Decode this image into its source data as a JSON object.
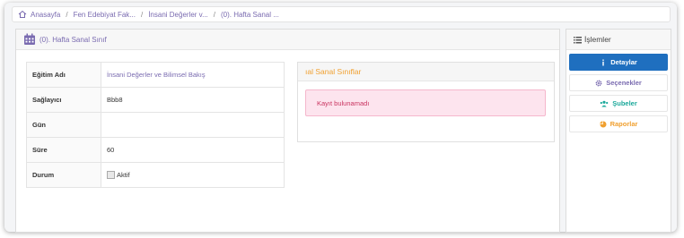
{
  "breadcrumb": {
    "items": [
      "Anasayfa",
      "Fen Edebiyat Fak...",
      "İnsani Değerler v...",
      "(0). Hafta Sanal ..."
    ],
    "separator": "/"
  },
  "left_card": {
    "title": "(0). Hafta Sanal Sınıf"
  },
  "details": [
    {
      "label": "Eğitim Adı",
      "value": "İnsani Değerler ve Bilimsel Bakış"
    },
    {
      "label": "Sağlayıcı",
      "value": "Bbb8"
    },
    {
      "label": "Gün",
      "value": ""
    },
    {
      "label": "Süre",
      "value": "60"
    },
    {
      "label": "Durum",
      "value": "Aktif"
    }
  ],
  "virtual_classes": {
    "title": "ıal Sanal Sınıflar",
    "empty_message": "Kayıt bulunamadı"
  },
  "actions": {
    "title": "İşlemler",
    "items": [
      {
        "label": "Detaylar",
        "icon": "info-icon",
        "color": "#ffffff"
      },
      {
        "label": "Seçenekler",
        "icon": "cog-icon",
        "color": "#7a6bb0"
      },
      {
        "label": "Şubeler",
        "icon": "users-icon",
        "color": "#1aa89a"
      },
      {
        "label": "Raporlar",
        "icon": "pie-chart-icon",
        "color": "#f0a030"
      }
    ]
  },
  "colors": {
    "accent_purple": "#7a6bb0",
    "primary_blue": "#1f6fbf",
    "alert_pink": "#fde4ee",
    "warning_orange": "#f0a030",
    "teal": "#1aa89a"
  }
}
